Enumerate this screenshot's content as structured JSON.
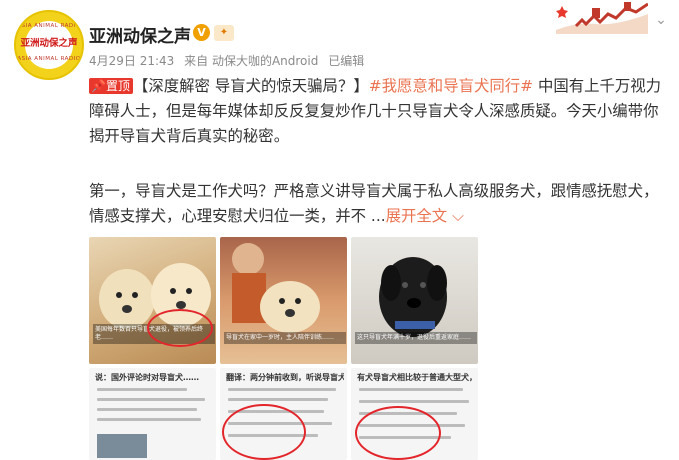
{
  "header": {
    "avatar_text": "亚洲动保之声",
    "avatar_ring_top": "ASIA ANIMAL RADIO",
    "avatar_ring_bottom": "ASIA ANIMAL RADIO",
    "account_name": "亚洲动保之声",
    "verified_icon": "verified-v-icon",
    "badge_icon": "fan-badge-icon",
    "time": "4月29日 21:43",
    "source": "来自 动保大咖的Android",
    "edited": "已编辑",
    "menu_icon": "chevron-down-icon"
  },
  "post": {
    "top_label": "置顶",
    "headline": "【深度解密 导盲犬的惊天骗局？】",
    "hashtag": "#我愿意和导盲犬同行#",
    "intro": " 中国有上千万视力障碍人士，但是每年媒体却反反复复炒作几十只导盲犬令人深感质疑。今天小编带你揭开导盲犬背后真实的秘密。",
    "body": "第一，导盲犬是工作犬吗？严格意义讲导盲犬属于私人高级服务犬，跟情感抚慰犬，情感支撑犬，心理安慰犬归位一类，并不 ...",
    "expand_label": "展开全文",
    "expand_icon": "chevron-down-icon"
  },
  "images": [
    {
      "caption": "美国每年数百只导盲犬退役，被领养后终老……"
    },
    {
      "caption": "导盲犬在家中一岁时，主人陪伴训练……"
    },
    {
      "caption": "这只导盲犬年满十岁，退役后重返家庭……"
    },
    {
      "heading": "说：国外评论时对导盲犬……"
    },
    {
      "heading": "翻译：两分钟前收到，听说导盲犬……"
    },
    {
      "heading": "有犬导盲犬相比较于普通大型犬，并非……"
    }
  ],
  "colors": {
    "accent": "#eb7350",
    "top_badge": "#e8372c",
    "verified": "#f0a100",
    "avatar_bg": "#f3d21c",
    "circle": "#e3262b"
  }
}
